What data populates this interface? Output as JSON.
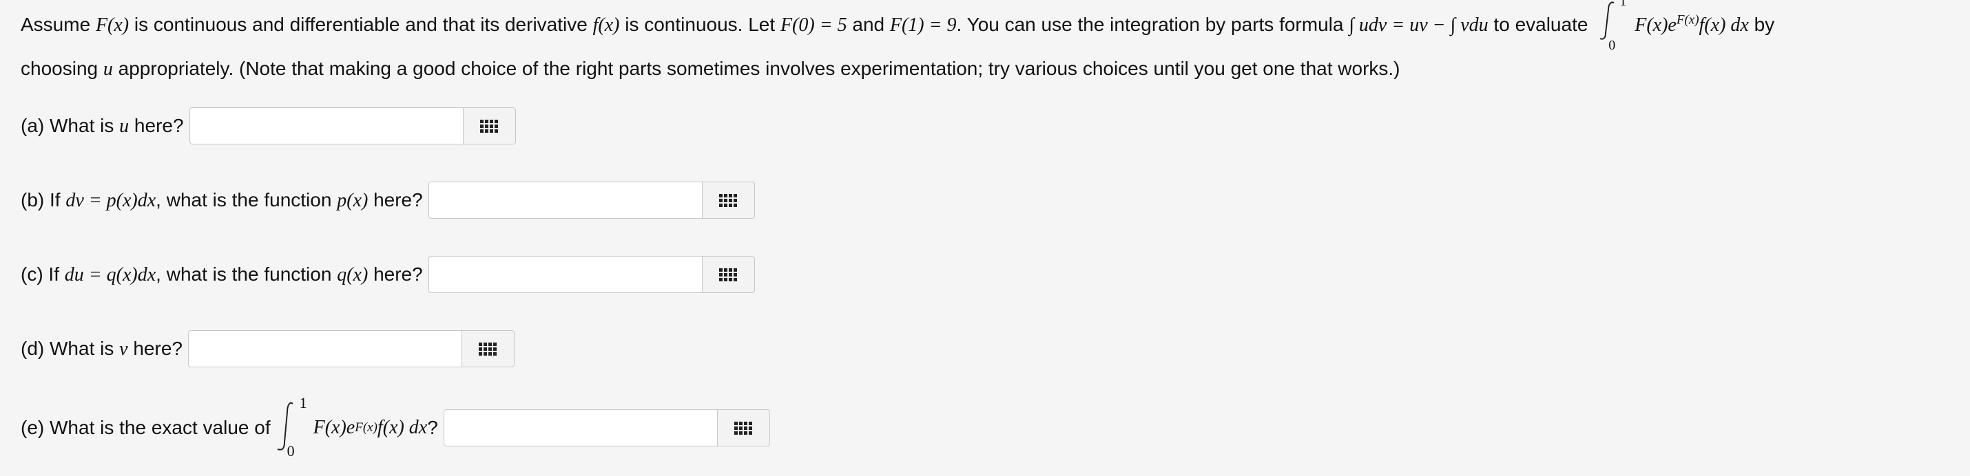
{
  "intro": {
    "p1": "Assume ",
    "Fx": "F(x)",
    "p2": " is continuous and differentiable and that its derivative ",
    "fx": "f(x)",
    "p3": " is continuous. Let ",
    "F0": "F(0) = 5",
    "p4": " and ",
    "F1": "F(1) = 9",
    "p5": ". You can use the integration by parts formula ",
    "formula": "∫ udv = uv − ∫ vdu",
    "p6": " to evaluate ",
    "integrand": "F(x)e",
    "exp": "F(x)",
    "integrand2": "f(x) dx",
    "p7": " by",
    "line2a": "choosing ",
    "u": "u",
    "line2b": " appropriately. (Note that making a good choice of the right parts sometimes involves experimentation; try various choices until you get one that works.)",
    "upper": "1",
    "lower": "0"
  },
  "questions": {
    "a": {
      "label_pre": "(a) What is ",
      "var": "u",
      "label_post": " here?",
      "value": "",
      "placeholder": ""
    },
    "b": {
      "label_pre": "(b) If ",
      "eq": "dv = p(x)dx",
      "label_mid": ", what is the function ",
      "fn": "p(x)",
      "label_post": " here?",
      "value": "",
      "placeholder": ""
    },
    "c": {
      "label_pre": "(c) If ",
      "eq": "du = q(x)dx",
      "label_mid": ", what is the function ",
      "fn": "q(x)",
      "label_post": " here?",
      "value": "",
      "placeholder": ""
    },
    "d": {
      "label_pre": "(d) What is ",
      "var": "v",
      "label_post": " here?",
      "value": "",
      "placeholder": ""
    },
    "e": {
      "label_pre": "(e) What is the exact value of ",
      "upper": "1",
      "lower": "0",
      "integrand": "F(x)e",
      "exp": "F(x)",
      "integrand2": "f(x) dx",
      "label_post": "?",
      "value": "",
      "placeholder": ""
    }
  },
  "icons": {
    "palette": "grid-palette-icon"
  }
}
